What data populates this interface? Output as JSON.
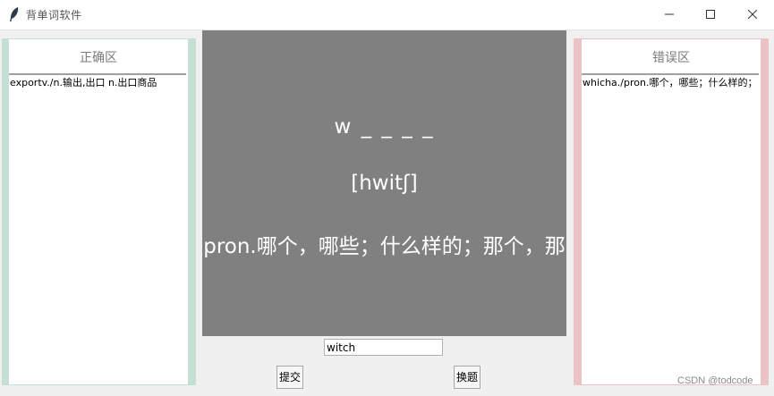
{
  "window": {
    "title": "背单词软件",
    "controls": {
      "minimize_icon": "minimize-icon",
      "maximize_icon": "maximize-icon",
      "close_icon": "close-icon"
    }
  },
  "correct_panel": {
    "title": "正确区",
    "items": [
      "exportv./n.输出,出口 n.出口商品"
    ],
    "border_color": "#c5dfd3"
  },
  "wrong_panel": {
    "title": "错误区",
    "items": [
      "whicha./pron.哪个，哪些；什么样的；"
    ],
    "border_color": "#ebc3c6"
  },
  "card": {
    "word_hint": "w _ _ _ _",
    "phonetic": "[hwitʃ]",
    "definition": "pron.哪个，哪些；什么样的；那个，那",
    "background": "#808080"
  },
  "answer": {
    "value": "witch"
  },
  "buttons": {
    "submit": "提交",
    "change": "换题"
  },
  "watermark": "CSDN @todcode"
}
